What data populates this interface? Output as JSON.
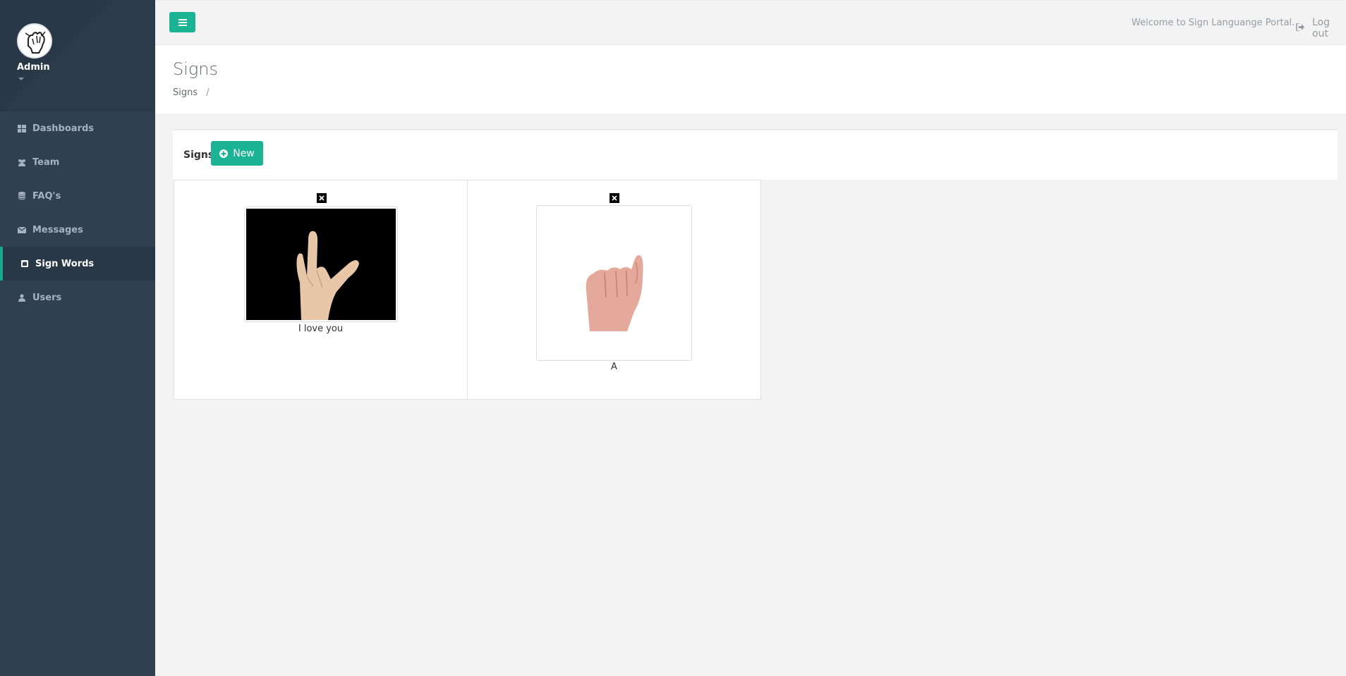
{
  "user": {
    "name": "Admin"
  },
  "nav": {
    "items": [
      {
        "label": "Dashboards",
        "icon": "dashboard-icon"
      },
      {
        "label": "Team",
        "icon": "users-group-icon"
      },
      {
        "label": "FAQ's",
        "icon": "database-icon"
      },
      {
        "label": "Messages",
        "icon": "envelope-icon"
      },
      {
        "label": "Sign Words",
        "icon": "sign-language-icon",
        "active": true
      },
      {
        "label": "Users",
        "icon": "user-icon"
      }
    ]
  },
  "topbar": {
    "welcome": "Welcome to Sign Languange Portal.",
    "logout": "Log out"
  },
  "heading": {
    "title": "Signs",
    "breadcrumb": "Signs",
    "separator": "/"
  },
  "panel": {
    "title": "Signs",
    "new_label": "New"
  },
  "signs": [
    {
      "caption": "I love you"
    },
    {
      "caption": "A"
    }
  ],
  "colors": {
    "sidebar": "#2f4050",
    "accent": "#1ab394"
  }
}
